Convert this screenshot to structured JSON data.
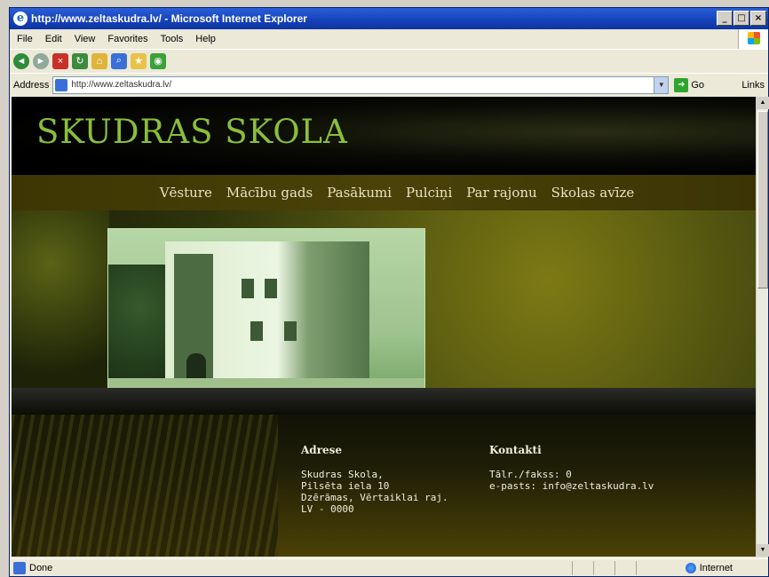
{
  "window": {
    "title": "http://www.zeltaskudra.lv/ - Microsoft Internet Explorer",
    "minimize": "_",
    "maximize": "□",
    "close": "×"
  },
  "menu": [
    "File",
    "Edit",
    "View",
    "Favorites",
    "Tools",
    "Help"
  ],
  "address": {
    "label": "Address",
    "value": "http://www.zeltaskudra.lv/",
    "go": "Go",
    "links": "Links"
  },
  "site": {
    "title": "SKUDRAS SKOLA",
    "nav": [
      "Vēsture",
      "Mācību gads",
      "Pasākumi",
      "Pulciņi",
      "Par rajonu",
      "Skolas avīze"
    ],
    "address_heading": "Adrese",
    "address_lines": [
      "Skudras Skola,",
      "Pilsēta iela 10",
      "Dzērāmas, Vērtaiklai raj.",
      "LV - 0000"
    ],
    "contacts_heading": "Kontakti",
    "contacts_lines": [
      "Tālr./fakss: 0",
      "e-pasts: info@zeltaskudra.lv"
    ]
  },
  "status": {
    "text": "Done",
    "zone": "Internet"
  }
}
